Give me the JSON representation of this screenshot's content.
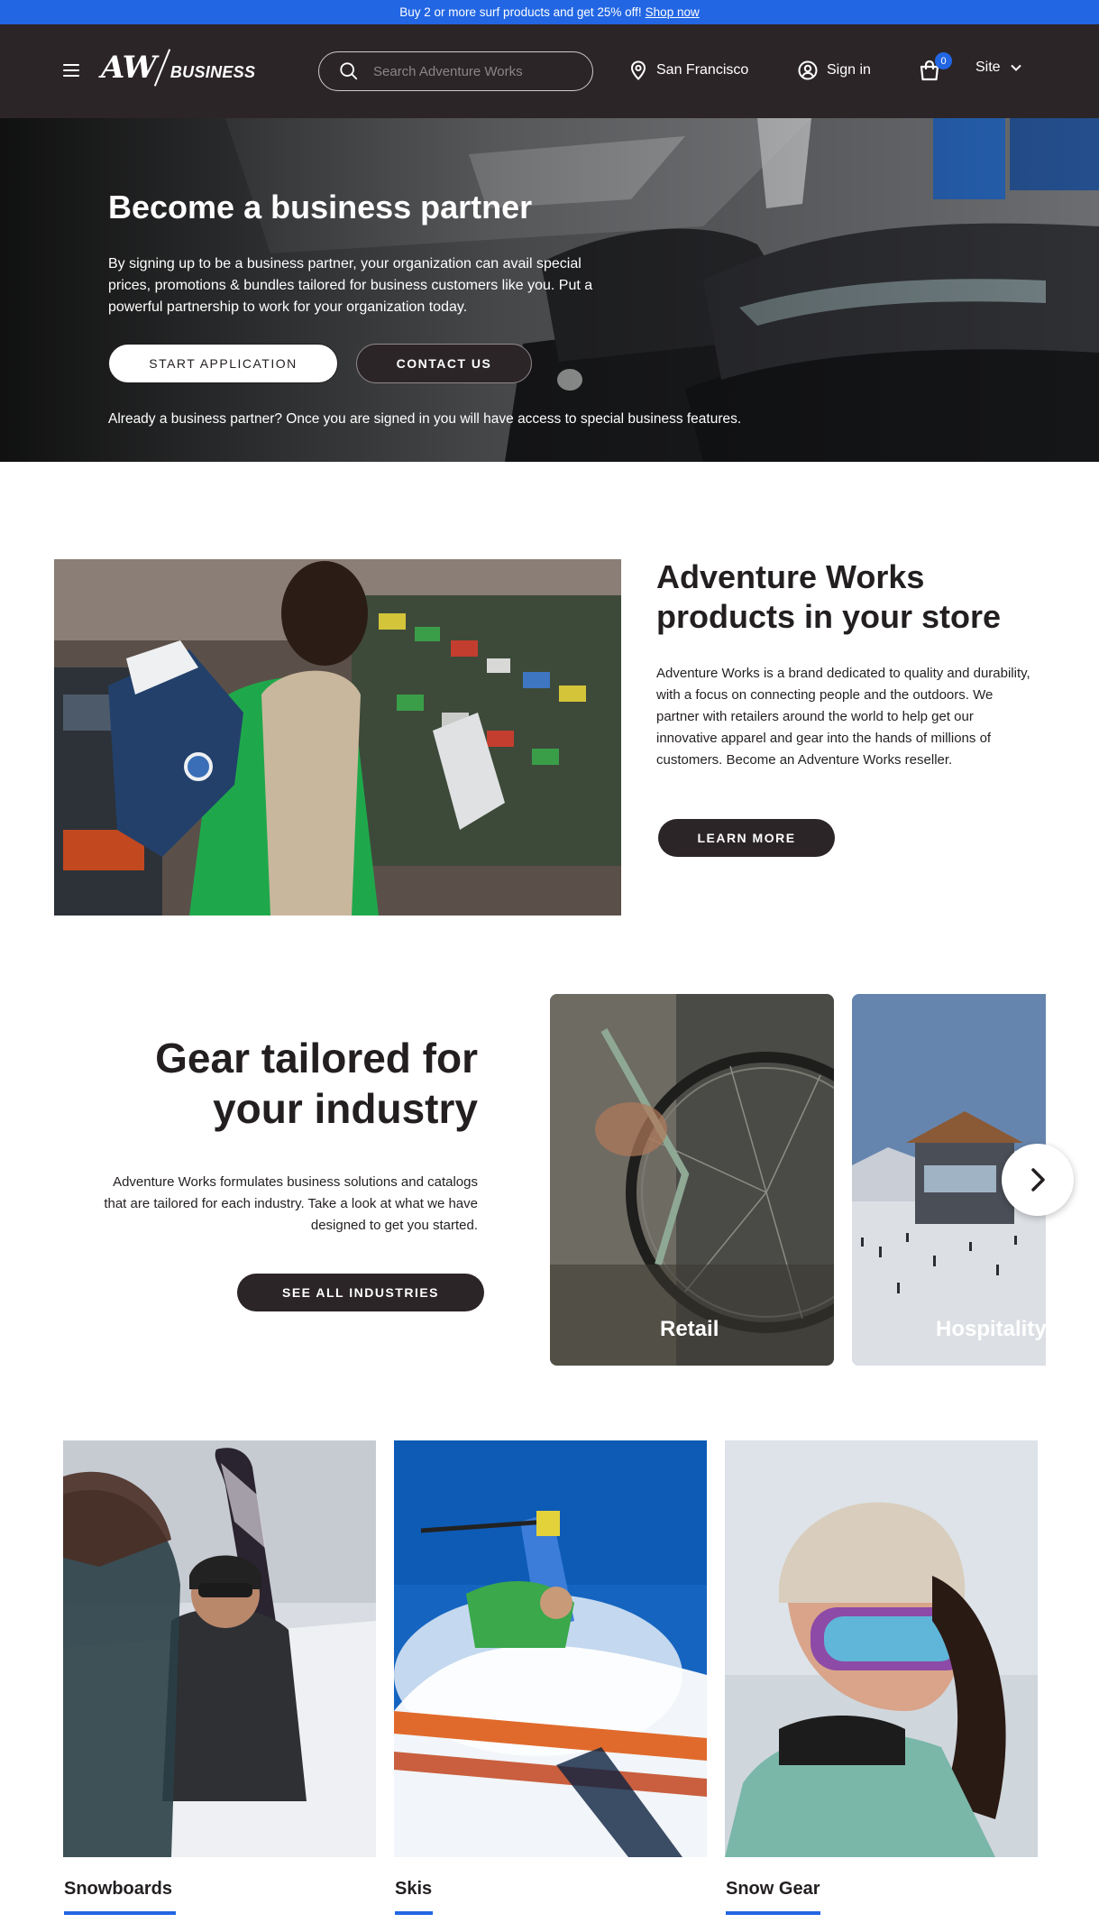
{
  "promo": {
    "text": "Buy 2 or more surf products and get 25% off!",
    "link": "Shop now"
  },
  "header": {
    "logo_mark": "AW",
    "logo_sub": "BUSINESS",
    "search_placeholder": "Search Adventure Works",
    "location": "San Francisco",
    "sign_in": "Sign in",
    "cart_count": "0",
    "site_menu": "Site",
    "icons": [
      "menu-icon",
      "search-icon",
      "location-pin-icon",
      "user-icon",
      "cart-icon",
      "chevron-down-icon"
    ]
  },
  "hero": {
    "title": "Become a business partner",
    "text": "By signing up to be a business partner, your organization can avail special prices, promotions & bundles tailored for business customers like you. Put a powerful partnership to work for your organization today.",
    "start_button": "START APPLICATION",
    "contact_button": "CONTACT US",
    "note": "Already a business partner? Once you are signed in you will have access to special business features."
  },
  "partner": {
    "title_line1": "Adventure Works",
    "title_line2": "products in your store",
    "text": "Adventure Works is a brand dedicated to quality and durability, with a focus on connecting people and the outdoors. We partner with retailers around the world to help get our innovative apparel and gear into the hands of millions of customers. Become an Adventure Works reseller.",
    "button": "LEARN MORE"
  },
  "industry": {
    "title_line1": "Gear tailored for",
    "title_line2": "your industry",
    "text": "Adventure Works formulates business solutions and catalogs that are tailored for each industry. Take a look at what we have designed to get you started.",
    "button": "SEE ALL INDUSTRIES",
    "cards": [
      {
        "label": "Retail"
      },
      {
        "label": "Hospitality"
      }
    ],
    "next_icon": "chevron-right-icon"
  },
  "categories": [
    {
      "label": "Snowboards"
    },
    {
      "label": "Skis"
    },
    {
      "label": "Snow Gear"
    }
  ],
  "colors": {
    "accent": "#2266e3",
    "dark": "#2c2527",
    "text": "#231f20"
  }
}
